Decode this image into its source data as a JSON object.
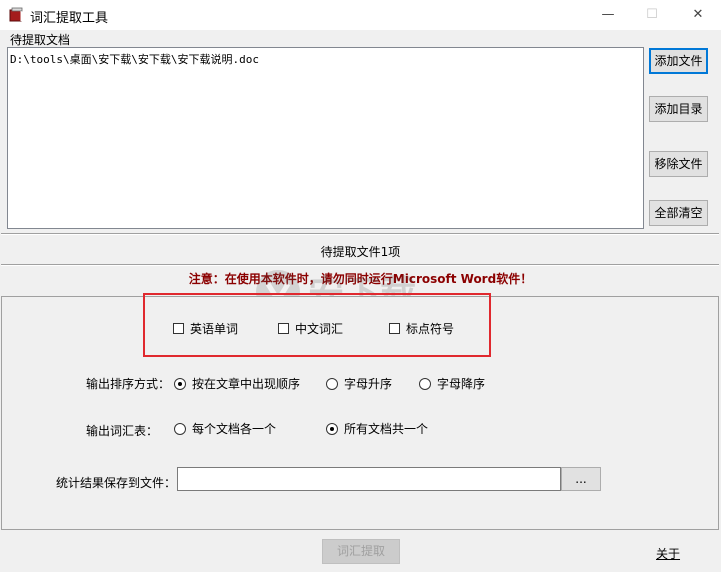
{
  "window": {
    "title": "词汇提取工具",
    "controls": {
      "minimize": "—",
      "maximize": "☐",
      "close": "✕"
    }
  },
  "files": {
    "group_label": "待提取文档",
    "items": [
      "D:\\tools\\桌面\\安下载\\安下载\\安下载说明.doc"
    ],
    "count_label": "待提取文件1项"
  },
  "side_buttons": {
    "add_file": "添加文件",
    "add_dir": "添加目录",
    "remove_file": "移除文件",
    "clear_all": "全部清空"
  },
  "warning": "注意：在使用本软件时，请勿同时运行Microsoft Word软件！",
  "options": {
    "checkboxes": [
      {
        "label": "英语单词",
        "checked": false
      },
      {
        "label": "中文词汇",
        "checked": false
      },
      {
        "label": "标点符号",
        "checked": false
      }
    ],
    "sort": {
      "label": "输出排序方式：",
      "choices": [
        {
          "label": "按在文章中出现顺序",
          "selected": true
        },
        {
          "label": "字母升序",
          "selected": false
        },
        {
          "label": "字母降序",
          "selected": false
        }
      ]
    },
    "output": {
      "label": "输出词汇表：",
      "choices": [
        {
          "label": "每个文档各一个",
          "selected": false
        },
        {
          "label": "所有文档共一个",
          "selected": true
        }
      ]
    },
    "save": {
      "label": "统计结果保存到文件：",
      "value": "",
      "browse_label": "..."
    }
  },
  "footer": {
    "extract_button": "词汇提取",
    "about_link": "关于"
  },
  "watermark_text": "安下载",
  "colors": {
    "highlight": "#e0282e",
    "warning": "#8b0000",
    "default_button": "#0078d7"
  }
}
